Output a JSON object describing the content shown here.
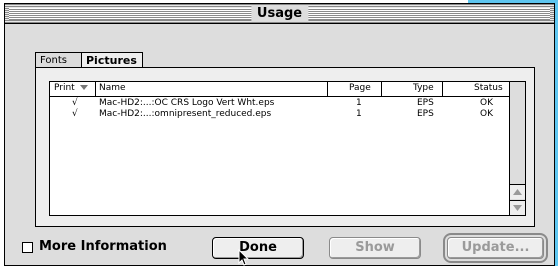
{
  "window": {
    "title": "Usage"
  },
  "tabs": [
    {
      "label": "Fonts",
      "active": false
    },
    {
      "label": "Pictures",
      "active": true
    }
  ],
  "list": {
    "columns": [
      "Print",
      "Name",
      "Page",
      "Type",
      "Status"
    ],
    "rows": [
      {
        "print": "√",
        "name": "Mac-HD2:...:OC CRS Logo Vert Wht.eps",
        "page": "1",
        "type": "EPS",
        "status": "OK"
      },
      {
        "print": "√",
        "name": "Mac-HD2:...:omnipresent_reduced.eps",
        "page": "1",
        "type": "EPS",
        "status": "OK"
      }
    ]
  },
  "footer": {
    "more_information_label": "More Information",
    "more_information_checked": false,
    "done_label": "Done",
    "show_label": "Show",
    "update_label": "Update..."
  },
  "colors": {
    "background_accent": "#5ec6f0"
  }
}
